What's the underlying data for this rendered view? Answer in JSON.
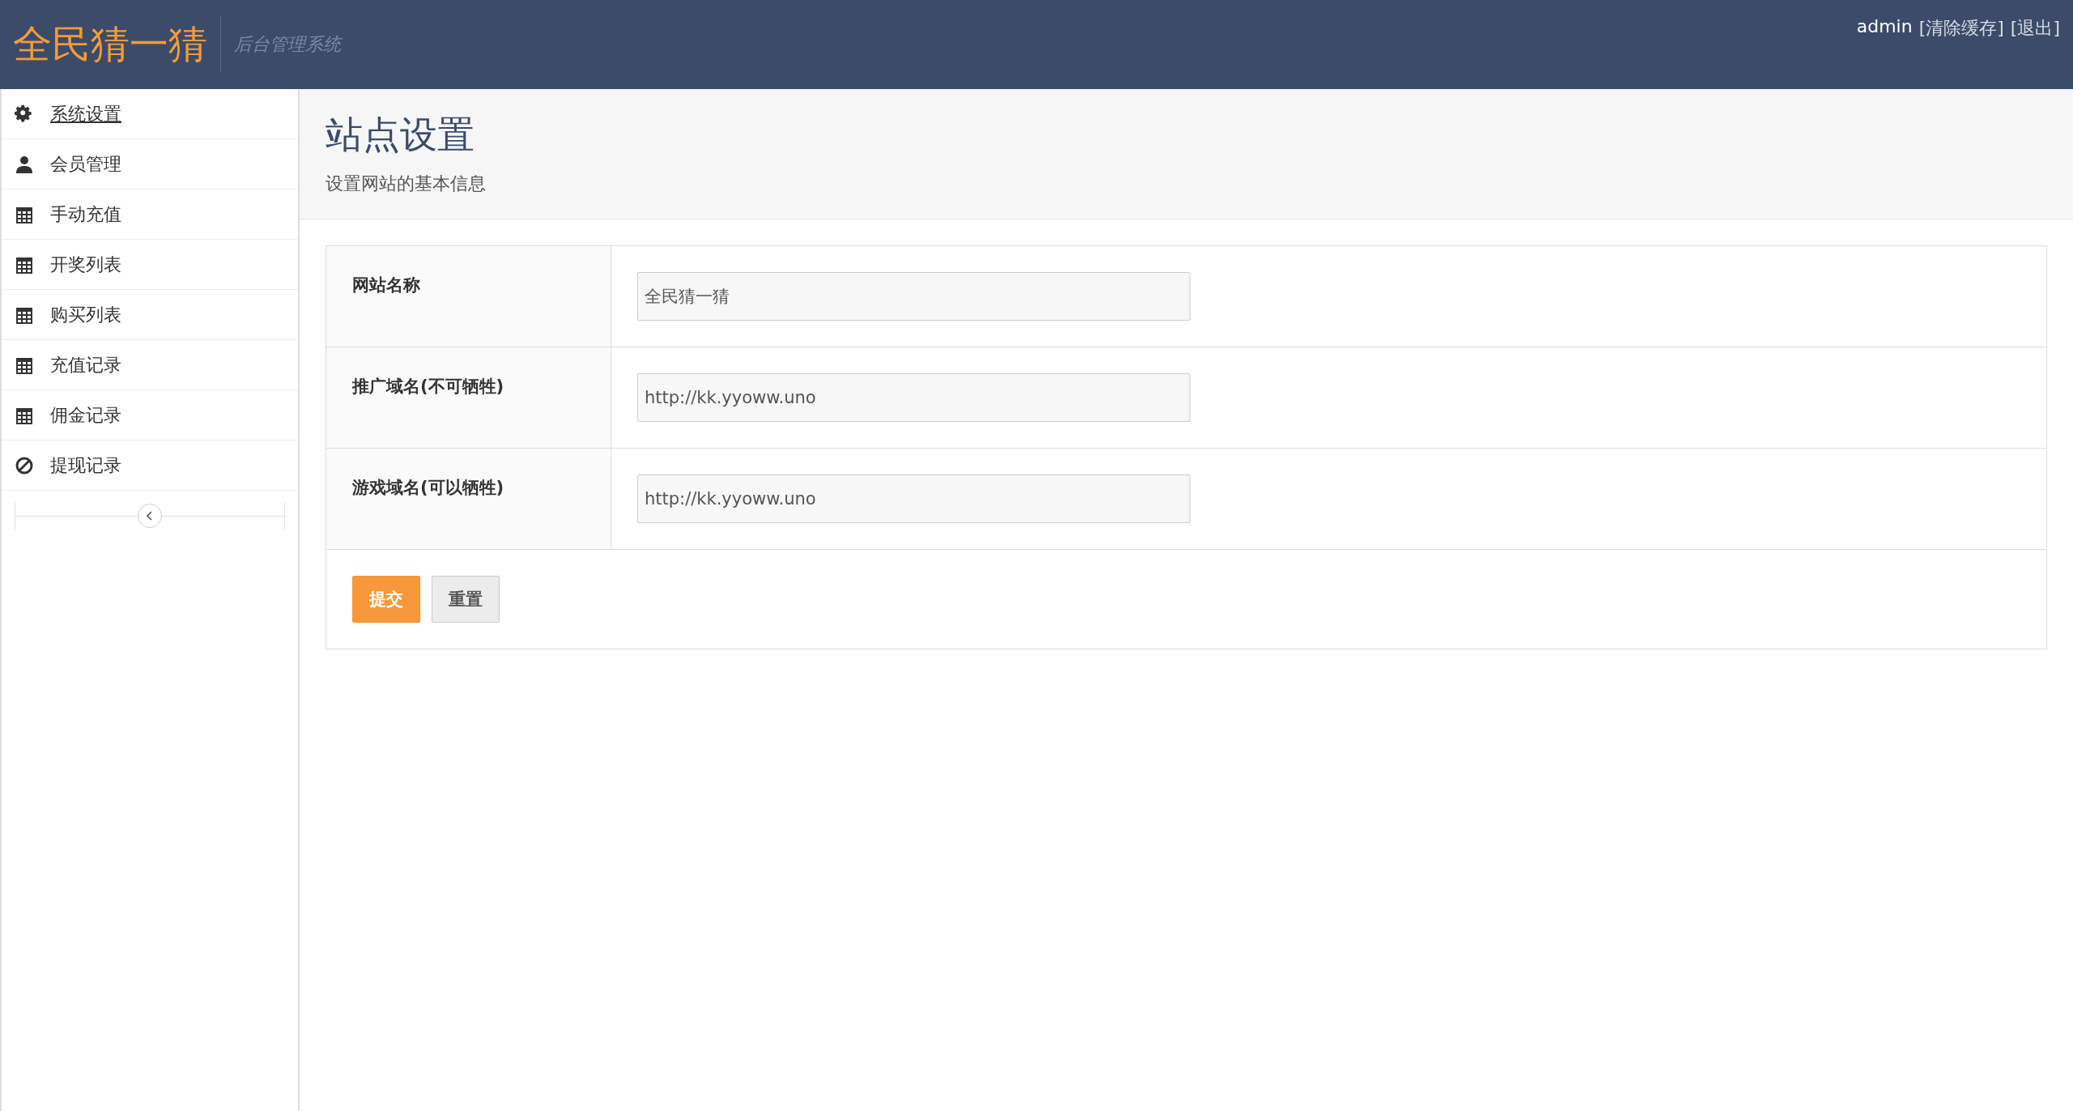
{
  "header": {
    "logo": "全民猜一猜",
    "subtitle": "后台管理系统",
    "user": "admin",
    "links": [
      "[清除缓存]",
      "[退出]"
    ]
  },
  "sidebar": {
    "items": [
      {
        "label": "系统设置",
        "kind": "gear",
        "selected": true
      },
      {
        "label": "会员管理",
        "kind": "user",
        "selected": false
      },
      {
        "label": "手动充值",
        "kind": "calendar",
        "selected": false
      },
      {
        "label": "开奖列表",
        "kind": "calendar",
        "selected": false
      },
      {
        "label": "购买列表",
        "kind": "calendar",
        "selected": false
      },
      {
        "label": "充值记录",
        "kind": "calendar",
        "selected": false
      },
      {
        "label": "佣金记录",
        "kind": "calendar",
        "selected": false
      },
      {
        "label": "提现记录",
        "kind": "ban",
        "selected": false
      }
    ]
  },
  "page": {
    "title": "站点设置",
    "subtitle": "设置网站的基本信息"
  },
  "form": {
    "fields": [
      {
        "label": "网站名称",
        "value": "全民猜一猜"
      },
      {
        "label": "推广域名(不可牺牲)",
        "value": "http://kk.yyoww.uno"
      },
      {
        "label": "游戏域名(可以牺牲)",
        "value": "http://kk.yyoww.uno"
      }
    ],
    "buttons": [
      {
        "label": "提交",
        "kind": "primary"
      },
      {
        "label": "重置",
        "kind": "default"
      }
    ]
  }
}
